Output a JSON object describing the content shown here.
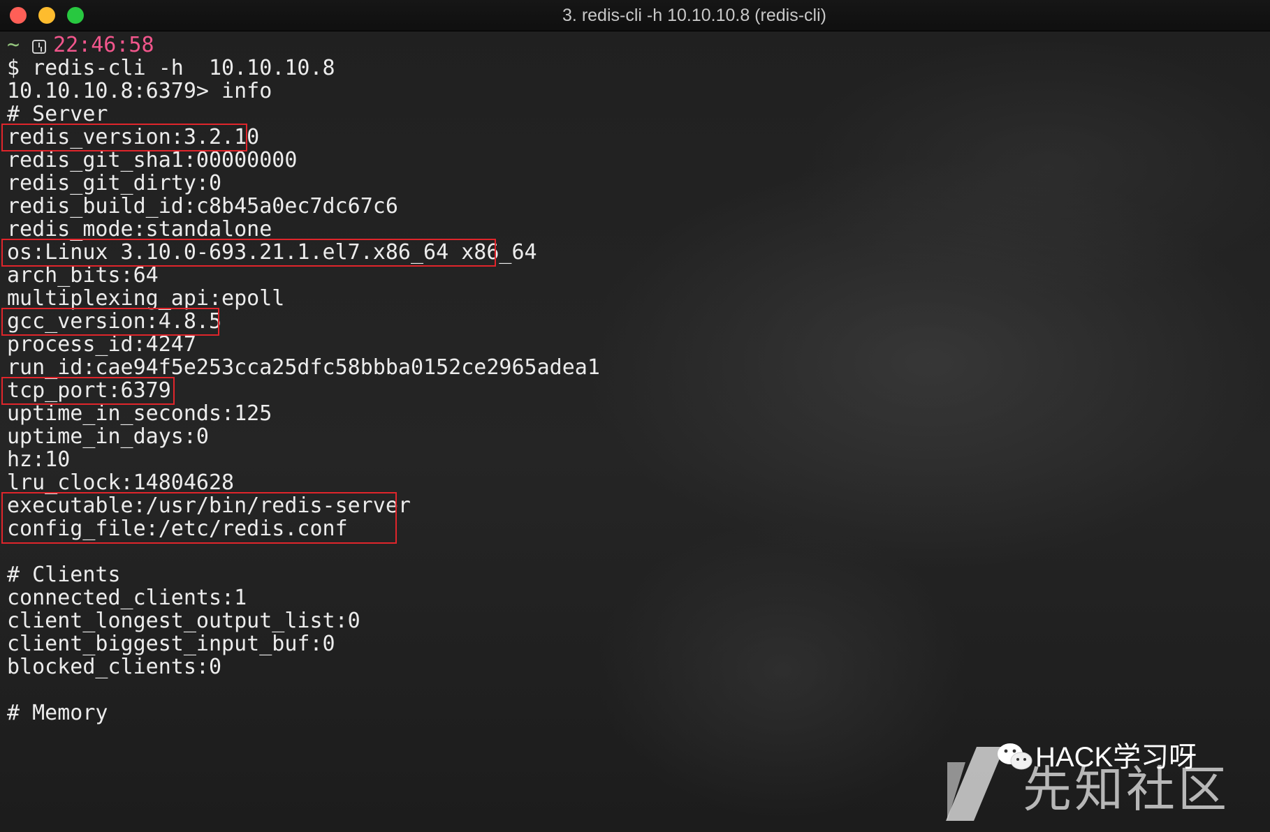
{
  "window": {
    "title": "3. redis-cli -h 10.10.10.8 (redis-cli)"
  },
  "prompt": {
    "cwd": "~",
    "time": "22:46:58",
    "command": "$ redis-cli -h  10.10.10.8",
    "redis_prompt": "10.10.10.8:6379> info"
  },
  "output": {
    "lines": [
      "# Server",
      "redis_version:3.2.10",
      "redis_git_sha1:00000000",
      "redis_git_dirty:0",
      "redis_build_id:c8b45a0ec7dc67c6",
      "redis_mode:standalone",
      "os:Linux 3.10.0-693.21.1.el7.x86_64 x86_64",
      "arch_bits:64",
      "multiplexing_api:epoll",
      "gcc_version:4.8.5",
      "process_id:4247",
      "run_id:cae94f5e253cca25dfc58bbba0152ce2965adea1",
      "tcp_port:6379",
      "uptime_in_seconds:125",
      "uptime_in_days:0",
      "hz:10",
      "lru_clock:14804628",
      "executable:/usr/bin/redis-server",
      "config_file:/etc/redis.conf",
      "",
      "# Clients",
      "connected_clients:1",
      "client_longest_output_list:0",
      "client_biggest_input_buf:0",
      "blocked_clients:0",
      "",
      "# Memory"
    ]
  },
  "watermark": {
    "small": "HACK学习呀",
    "big": "先知社区"
  },
  "colors": {
    "highlight_box": "#e0252b",
    "time": "#f2568c",
    "tilde": "#93c47d"
  }
}
